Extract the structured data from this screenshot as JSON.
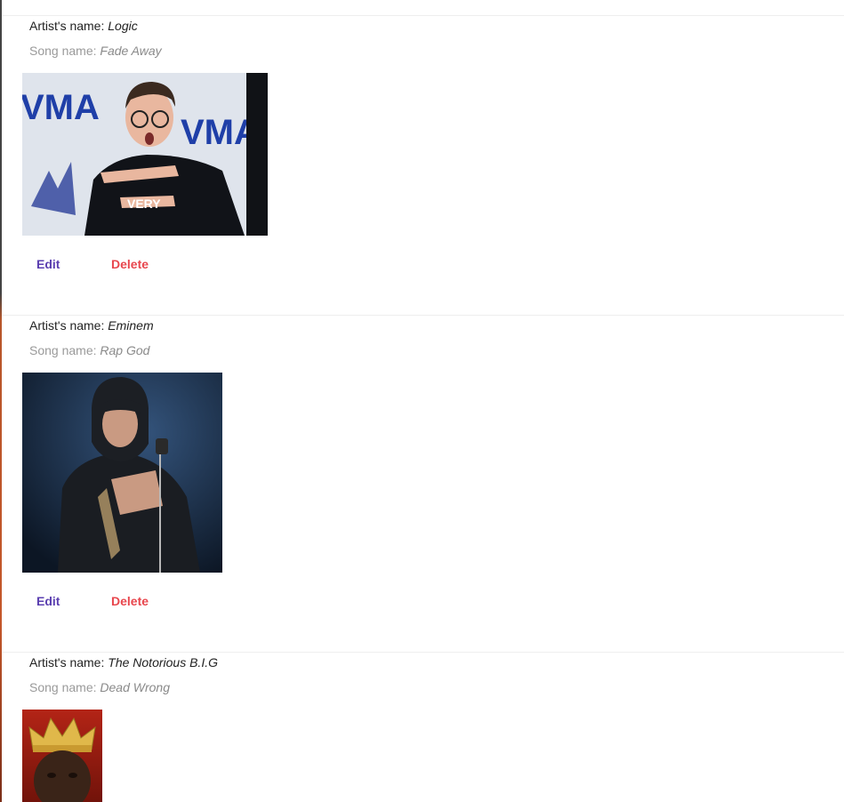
{
  "cards": [
    {
      "artist_label": "Artist's name:",
      "artist": "Logic",
      "song_label": "Song name:",
      "song": "Fade Away",
      "edit_label": "Edit",
      "delete_label": "Delete",
      "photo_text": "VMA"
    },
    {
      "artist_label": "Artist's name:",
      "artist": "Eminem",
      "song_label": "Song name:",
      "song": "Rap God",
      "edit_label": "Edit",
      "delete_label": "Delete"
    },
    {
      "artist_label": "Artist's name:",
      "artist": "The Notorious B.I.G",
      "song_label": "Song name:",
      "song": "Dead Wrong"
    }
  ],
  "colors": {
    "edit": "#5b3fb0",
    "delete": "#e8474e"
  }
}
